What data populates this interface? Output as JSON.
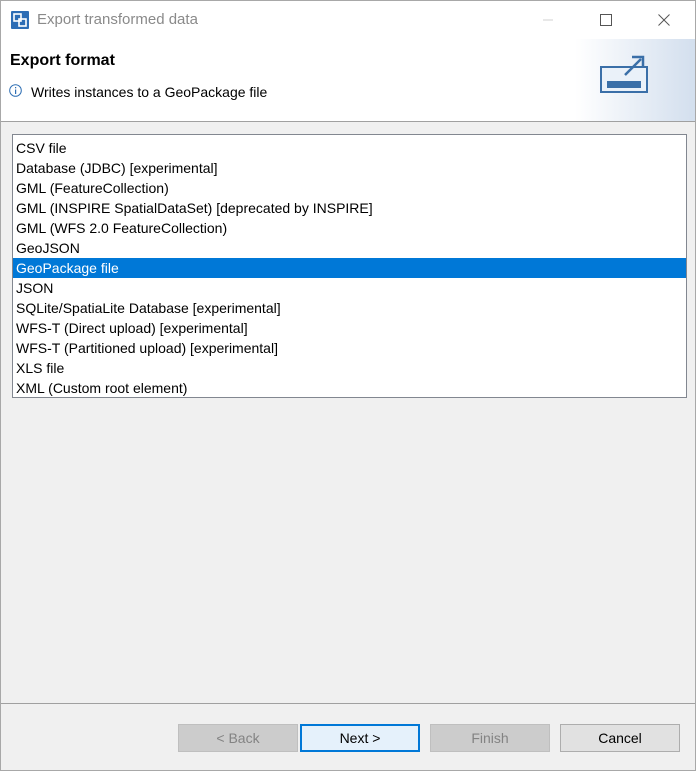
{
  "window": {
    "title": "Export transformed data"
  },
  "header": {
    "title": "Export format",
    "description": "Writes instances to a GeoPackage file"
  },
  "formats": {
    "selected_index": 6,
    "items": [
      "CSV file",
      "Database (JDBC) [experimental]",
      "GML (FeatureCollection)",
      "GML (INSPIRE SpatialDataSet) [deprecated by INSPIRE]",
      "GML (WFS 2.0 FeatureCollection)",
      "GeoJSON",
      "GeoPackage file",
      "JSON",
      "SQLite/SpatiaLite Database [experimental]",
      "WFS-T (Direct upload) [experimental]",
      "WFS-T (Partitioned upload) [experimental]",
      "XLS file",
      "XML (Custom root element)"
    ]
  },
  "buttons": {
    "back": "< Back",
    "next": "Next >",
    "finish": "Finish",
    "cancel": "Cancel"
  },
  "colors": {
    "selection": "#0078d7",
    "window_bg": "#f0f0f0"
  }
}
